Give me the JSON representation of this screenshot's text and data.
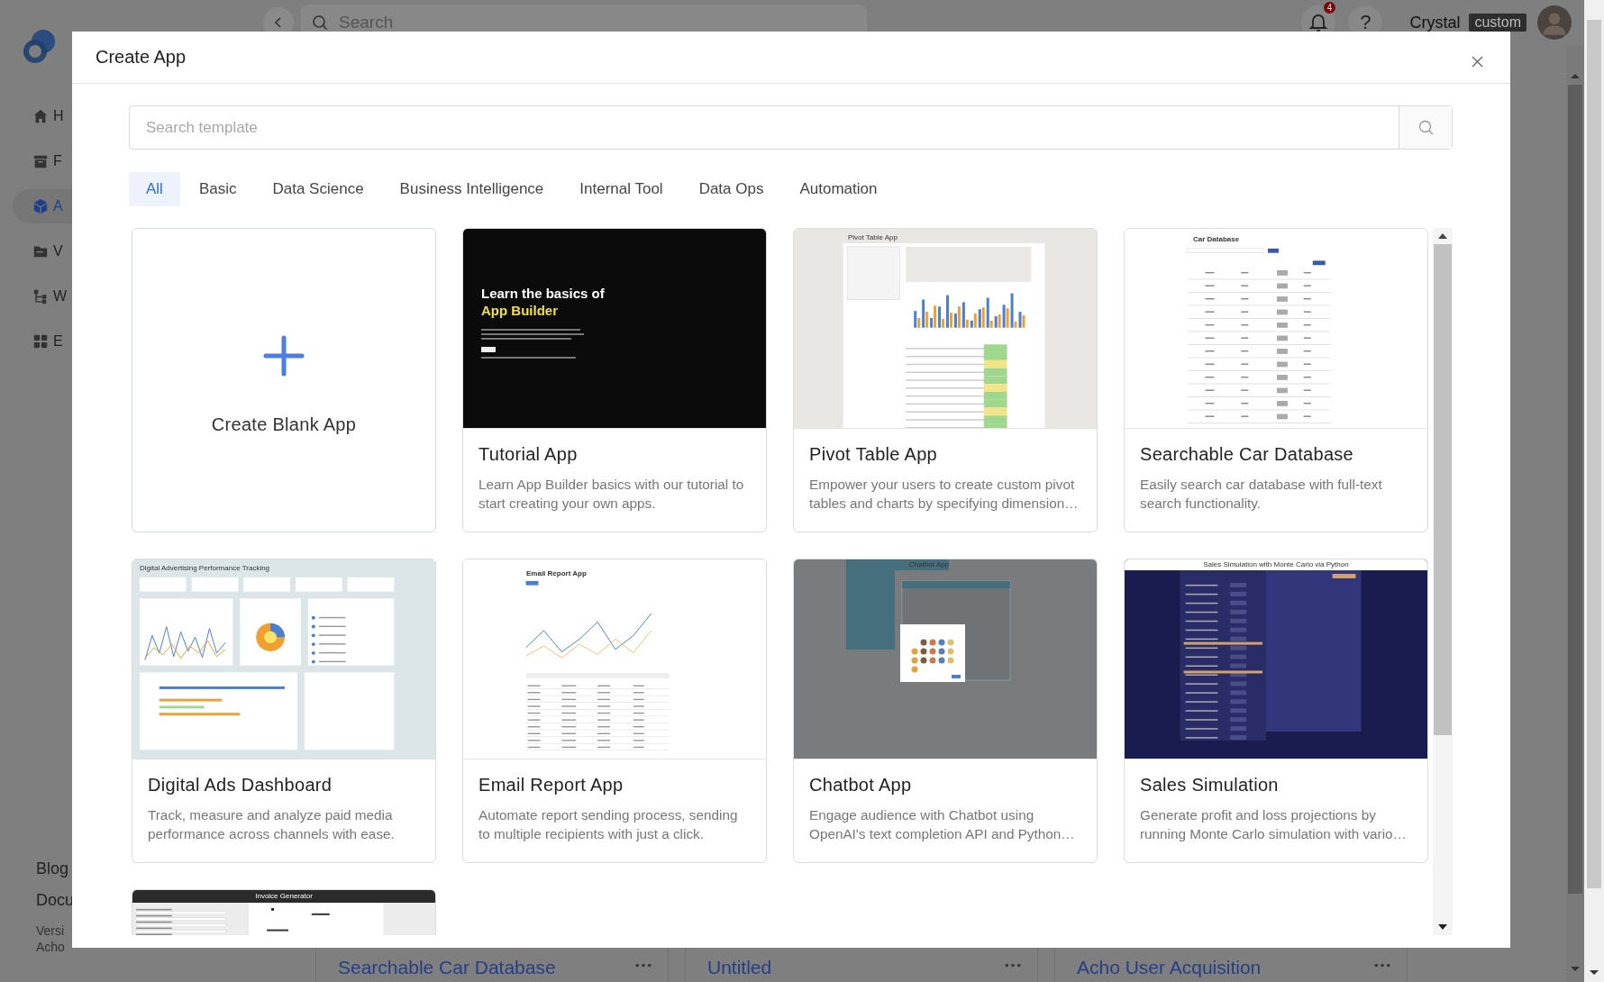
{
  "app": {
    "search": {
      "placeholder": "Search"
    },
    "notifications": {
      "count": "4"
    },
    "help": "?",
    "user": {
      "name": "Crystal",
      "badge": "custom"
    },
    "sidebar": {
      "items": [
        {
          "label": "H",
          "selected": false
        },
        {
          "label": "F",
          "selected": false
        },
        {
          "label": "A",
          "selected": true
        },
        {
          "label": "V",
          "selected": false
        },
        {
          "label": "W",
          "selected": false
        },
        {
          "label": "E",
          "selected": false
        }
      ],
      "footer_links": [
        "Blog",
        "Docu"
      ],
      "footer_notes": [
        "Versi",
        "Acho"
      ]
    },
    "background_cards": [
      {
        "title": "Searchable Car Database"
      },
      {
        "title": "Untitled"
      },
      {
        "title": "Acho User Acquisition"
      }
    ]
  },
  "dialog": {
    "title": "Create App",
    "search": {
      "placeholder": "Search template"
    },
    "tabs": [
      {
        "label": "All",
        "selected": true
      },
      {
        "label": "Basic",
        "selected": false
      },
      {
        "label": "Data Science",
        "selected": false
      },
      {
        "label": "Business Intelligence",
        "selected": false
      },
      {
        "label": "Internal Tool",
        "selected": false
      },
      {
        "label": "Data Ops",
        "selected": false
      },
      {
        "label": "Automation",
        "selected": false
      }
    ],
    "cards": [
      {
        "kind": "blank",
        "title": "Create Blank App"
      },
      {
        "kind": "template",
        "title": "Tutorial App",
        "description": "Learn App Builder basics with our tutorial to start creating your own apps.",
        "preview": {
          "kind": "tutorial",
          "heading": "Learn the basics of",
          "accent": "App Builder"
        }
      },
      {
        "kind": "template",
        "title": "Pivot Table App",
        "description": "Empower your users to create custom pivot tables and charts by specifying dimension…",
        "preview": {
          "kind": "pivot",
          "heading": "Pivot Table App"
        }
      },
      {
        "kind": "template",
        "title": "Searchable Car Database",
        "description": "Easily search car database with full-text search functionality.",
        "preview": {
          "kind": "table",
          "heading": "Car Database"
        }
      },
      {
        "kind": "template",
        "title": "Digital Ads Dashboard",
        "description": "Track, measure and analyze paid media performance across channels with ease.",
        "preview": {
          "kind": "dashboard",
          "heading": "Digital Advertising Performance Tracking"
        }
      },
      {
        "kind": "template",
        "title": "Email Report App",
        "description": "Automate report sending process, sending to multiple recipients with just a click.",
        "preview": {
          "kind": "email",
          "heading": "Email Report App"
        }
      },
      {
        "kind": "template",
        "title": "Chatbot App",
        "description": "Engage audience with Chatbot using OpenAI's text completion API and Python…",
        "preview": {
          "kind": "chatbot",
          "heading": "Chatbot App"
        }
      },
      {
        "kind": "template",
        "title": "Sales Simulation",
        "description": "Generate profit and loss projections by running Monte Carlo simulation with vario…",
        "preview": {
          "kind": "sales",
          "heading": "Sales Simulation with Monte Carlo via Python"
        }
      },
      {
        "kind": "template",
        "preview": {
          "kind": "invoice",
          "heading": "Invoice Generator"
        }
      }
    ]
  }
}
